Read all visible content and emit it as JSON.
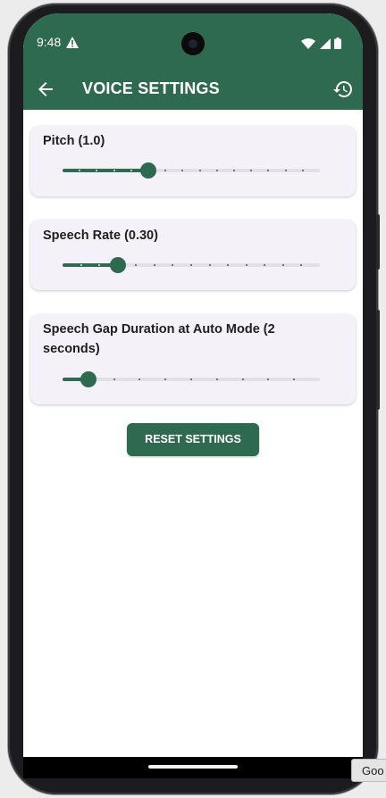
{
  "status_bar": {
    "time": "9:48"
  },
  "app_bar": {
    "title": "VOICE SETTINGS"
  },
  "settings": [
    {
      "label": "Pitch (1.0)",
      "value": 1.0,
      "min": 0,
      "max": 3,
      "divisions": 15
    },
    {
      "label": "Speech Rate (0.30)",
      "value": 0.3,
      "min": 0,
      "max": 1.4,
      "divisions": 14
    },
    {
      "label": "Speech Gap Duration at Auto Mode (2 seconds)",
      "value": 2,
      "min": 1,
      "max": 11,
      "divisions": 10
    }
  ],
  "reset_button": {
    "label": "RESET SETTINGS"
  },
  "tooltip": {
    "text": "Goo"
  },
  "colors": {
    "primary": "#2e6a4f",
    "card": "#f4f1f8",
    "track": "#e3dfe7"
  }
}
